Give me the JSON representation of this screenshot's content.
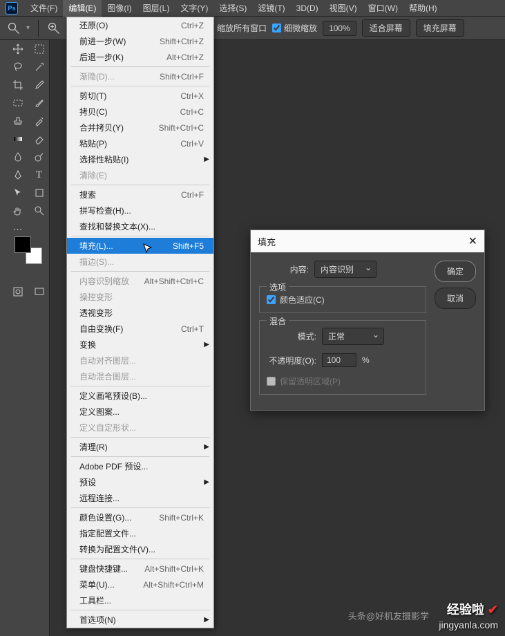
{
  "app": {
    "logo": "Ps"
  },
  "menu": {
    "items": [
      "文件(F)",
      "编辑(E)",
      "图像(I)",
      "图层(L)",
      "文字(Y)",
      "选择(S)",
      "滤镜(T)",
      "3D(D)",
      "视图(V)",
      "窗口(W)",
      "帮助(H)"
    ],
    "active_index": 1
  },
  "toolbar": {
    "fit_all": "缩放所有窗口",
    "fine_zoom": "细微缩放",
    "zoom_value": "100%",
    "fit_screen": "适合屏幕",
    "fill_screen": "填充屏幕"
  },
  "dropdown": [
    {
      "type": "item",
      "label": "还原(O)",
      "shortcut": "Ctrl+Z"
    },
    {
      "type": "item",
      "label": "前进一步(W)",
      "shortcut": "Shift+Ctrl+Z"
    },
    {
      "type": "item",
      "label": "后退一步(K)",
      "shortcut": "Alt+Ctrl+Z"
    },
    {
      "type": "sep"
    },
    {
      "type": "item",
      "label": "渐隐(D)...",
      "shortcut": "Shift+Ctrl+F",
      "disabled": true
    },
    {
      "type": "sep"
    },
    {
      "type": "item",
      "label": "剪切(T)",
      "shortcut": "Ctrl+X"
    },
    {
      "type": "item",
      "label": "拷贝(C)",
      "shortcut": "Ctrl+C"
    },
    {
      "type": "item",
      "label": "合并拷贝(Y)",
      "shortcut": "Shift+Ctrl+C"
    },
    {
      "type": "item",
      "label": "粘贴(P)",
      "shortcut": "Ctrl+V"
    },
    {
      "type": "item",
      "label": "选择性粘贴(I)",
      "submenu": true
    },
    {
      "type": "item",
      "label": "清除(E)",
      "disabled": true
    },
    {
      "type": "sep"
    },
    {
      "type": "item",
      "label": "搜索",
      "shortcut": "Ctrl+F"
    },
    {
      "type": "item",
      "label": "拼写检查(H)..."
    },
    {
      "type": "item",
      "label": "查找和替换文本(X)..."
    },
    {
      "type": "sep"
    },
    {
      "type": "item",
      "label": "填充(L)...",
      "shortcut": "Shift+F5",
      "highlight": true
    },
    {
      "type": "item",
      "label": "描边(S)...",
      "disabled": true
    },
    {
      "type": "sep"
    },
    {
      "type": "item",
      "label": "内容识别缩放",
      "shortcut": "Alt+Shift+Ctrl+C",
      "disabled": true
    },
    {
      "type": "item",
      "label": "操控变形",
      "disabled": true
    },
    {
      "type": "item",
      "label": "透视变形"
    },
    {
      "type": "item",
      "label": "自由变换(F)",
      "shortcut": "Ctrl+T"
    },
    {
      "type": "item",
      "label": "变换",
      "submenu": true
    },
    {
      "type": "item",
      "label": "自动对齐图层...",
      "disabled": true
    },
    {
      "type": "item",
      "label": "自动混合图层...",
      "disabled": true
    },
    {
      "type": "sep"
    },
    {
      "type": "item",
      "label": "定义画笔预设(B)..."
    },
    {
      "type": "item",
      "label": "定义图案..."
    },
    {
      "type": "item",
      "label": "定义自定形状...",
      "disabled": true
    },
    {
      "type": "sep"
    },
    {
      "type": "item",
      "label": "清理(R)",
      "submenu": true
    },
    {
      "type": "sep"
    },
    {
      "type": "item",
      "label": "Adobe PDF 预设..."
    },
    {
      "type": "item",
      "label": "预设",
      "submenu": true
    },
    {
      "type": "item",
      "label": "远程连接..."
    },
    {
      "type": "sep"
    },
    {
      "type": "item",
      "label": "颜色设置(G)...",
      "shortcut": "Shift+Ctrl+K"
    },
    {
      "type": "item",
      "label": "指定配置文件..."
    },
    {
      "type": "item",
      "label": "转换为配置文件(V)..."
    },
    {
      "type": "sep"
    },
    {
      "type": "item",
      "label": "键盘快捷键...",
      "shortcut": "Alt+Shift+Ctrl+K"
    },
    {
      "type": "item",
      "label": "菜单(U)...",
      "shortcut": "Alt+Shift+Ctrl+M"
    },
    {
      "type": "item",
      "label": "工具栏..."
    },
    {
      "type": "sep"
    },
    {
      "type": "item",
      "label": "首选项(N)",
      "submenu": true
    }
  ],
  "dialog": {
    "title": "填充",
    "content_label": "内容:",
    "content_value": "内容识别",
    "ok": "确定",
    "cancel": "取消",
    "options_legend": "选项",
    "color_adapt": "颜色适应(C)",
    "blend_legend": "混合",
    "mode_label": "模式:",
    "mode_value": "正常",
    "opacity_label": "不透明度(O):",
    "opacity_value": "100",
    "opacity_unit": "%",
    "preserve_trans": "保留透明区域(P)"
  },
  "watermark": {
    "main": "经验啦",
    "sub": "jingyanla.com",
    "headline": "头条@好机友摄影学"
  }
}
